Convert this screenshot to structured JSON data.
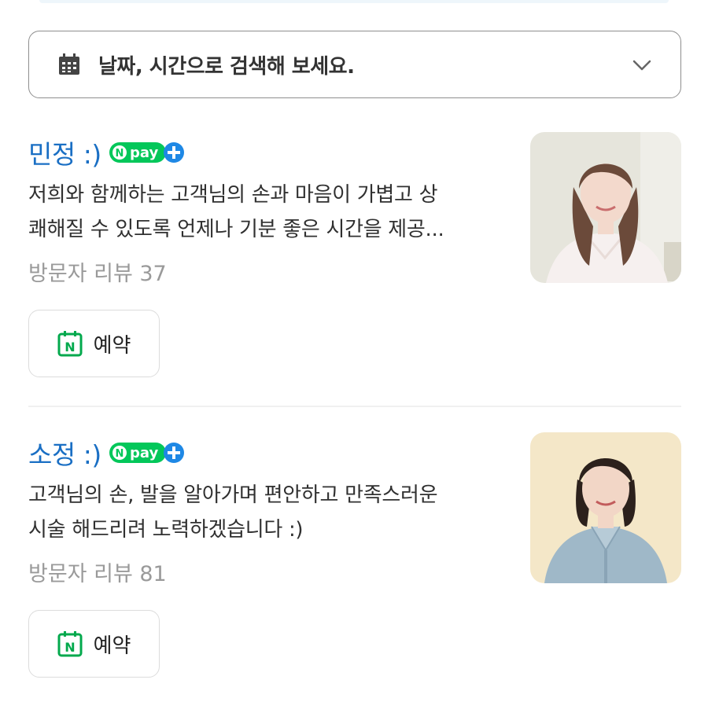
{
  "date_search": {
    "label": "날짜, 시간으로 검색해 보세요.",
    "icon": "calendar-icon",
    "chevron": "chevron-down-icon"
  },
  "staff": [
    {
      "name": "민정 :)",
      "badge": "Npay+",
      "description_lines": [
        "저희와 함께하는 고객님의 손과 마음이 가볍고 상",
        "쾌해질 수 있도록 언제나 기분 좋은 시간을 제공..."
      ],
      "reviews": "방문자 리뷰 37",
      "reserve_label": "예약"
    },
    {
      "name": "소정 :)",
      "badge": "Npay+",
      "description_lines": [
        "고객님의 손, 발을 알아가며 편안하고 만족스러운",
        "시술 해드리려 노력하겠습니다 :)"
      ],
      "reviews": "방문자 리뷰 81",
      "reserve_label": "예약"
    }
  ],
  "colors": {
    "name_blue": "#1a6fc4",
    "npay_green": "#03c75a",
    "npay_blue": "#1e88e5",
    "book_green": "#03a94d"
  }
}
